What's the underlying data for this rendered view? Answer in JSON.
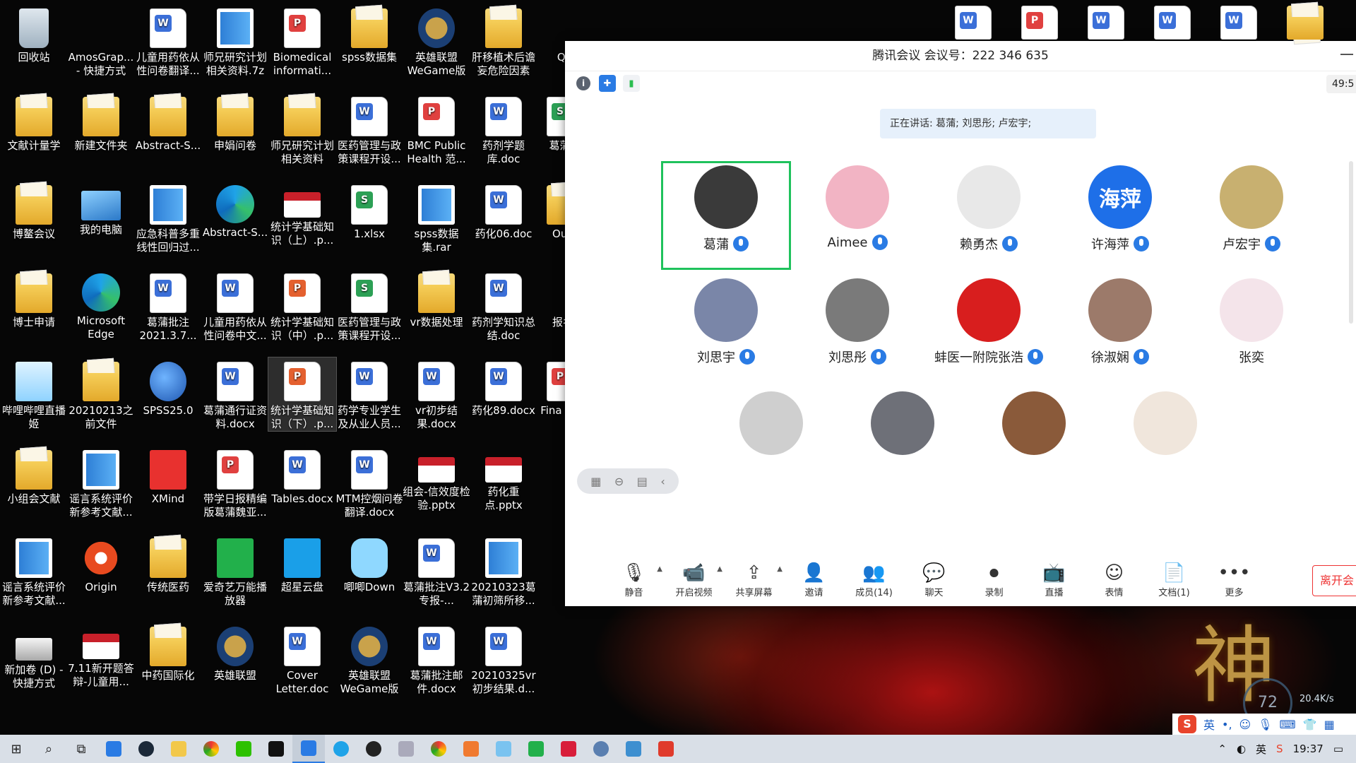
{
  "meeting": {
    "title": "腾讯会议 会议号：222 346 635",
    "timer": "49:5",
    "speaking": "正在讲话: 葛蒲; 刘思彤; 卢宏宇;",
    "participants": [
      {
        "name": "葛蒲",
        "avatar_color": "#3a3a3a",
        "avatar_text": ""
      },
      {
        "name": "Aimee",
        "avatar_color": "#f2b4c4",
        "avatar_text": ""
      },
      {
        "name": "赖勇杰",
        "avatar_color": "#e8e8e8",
        "avatar_text": ""
      },
      {
        "name": "许海萍",
        "avatar_color": "#1e6fe8",
        "avatar_text": "海萍"
      },
      {
        "name": "卢宏宇",
        "avatar_color": "#c8b070",
        "avatar_text": ""
      },
      {
        "name": "刘思宇",
        "avatar_color": "#7a86a8",
        "avatar_text": ""
      },
      {
        "name": "刘思彤",
        "avatar_color": "#7a7a7a",
        "avatar_text": ""
      },
      {
        "name": "蚌医一附院张浩",
        "avatar_color": "#d81e1e",
        "avatar_text": ""
      },
      {
        "name": "徐淑娴",
        "avatar_color": "#9c7a6a",
        "avatar_text": ""
      },
      {
        "name": "张奕",
        "avatar_color": "#f4e4ea",
        "avatar_text": ""
      },
      {
        "name": "",
        "avatar_color": "#cfcfcf",
        "avatar_text": ""
      },
      {
        "name": "",
        "avatar_color": "#6e7078",
        "avatar_text": ""
      },
      {
        "name": "",
        "avatar_color": "#8a5a3a",
        "avatar_text": ""
      },
      {
        "name": "",
        "avatar_color": "#f0e6dc",
        "avatar_text": ""
      }
    ],
    "toolbar": [
      {
        "label": "静音",
        "icon": "microphone-icon",
        "glyph": "🎙",
        "caret": true
      },
      {
        "label": "开启视频",
        "icon": "video-off-icon",
        "glyph": "📹",
        "caret": true
      },
      {
        "label": "共享屏幕",
        "icon": "share-screen-icon",
        "glyph": "⇪",
        "caret": true
      },
      {
        "label": "邀请",
        "icon": "invite-icon",
        "glyph": "👤",
        "caret": false
      },
      {
        "label": "成员(14)",
        "icon": "members-icon",
        "glyph": "👥",
        "caret": false
      },
      {
        "label": "聊天",
        "icon": "chat-icon",
        "glyph": "💬",
        "caret": false
      },
      {
        "label": "录制",
        "icon": "record-icon",
        "glyph": "⏺",
        "caret": false
      },
      {
        "label": "直播",
        "icon": "live-icon",
        "glyph": "📺",
        "caret": false
      },
      {
        "label": "表情",
        "icon": "emoji-icon",
        "glyph": "☺",
        "caret": false
      },
      {
        "label": "文档(1)",
        "icon": "document-icon",
        "glyph": "📄",
        "caret": false
      },
      {
        "label": "更多",
        "icon": "more-icon",
        "glyph": "•••",
        "caret": false
      }
    ],
    "leave": "离开会"
  },
  "desktop": {
    "icons": [
      [
        "回收站",
        "recycle"
      ],
      [
        "AmosGrap... - 快捷方式",
        "app-amos"
      ],
      [
        "儿童用药依从性问卷翻译...",
        "word"
      ],
      [
        "师兄研究计划相关资料.7z",
        "zip"
      ],
      [
        "Biomedical informati...",
        "pdf"
      ],
      [
        "spss数据集",
        "folder"
      ],
      [
        "英雄联盟 WeGame版",
        "lol"
      ],
      [
        "肝移植术后谵妄危险因素",
        "folder"
      ],
      [
        "QC",
        "app"
      ],
      [
        "文献计量学",
        "folder"
      ],
      [
        "新建文件夹",
        "folder"
      ],
      [
        "Abstract-S...",
        "folder"
      ],
      [
        "申娟问卷",
        "folder"
      ],
      [
        "师兄研究计划相关资料",
        "folder"
      ],
      [
        "医药管理与政策课程开设...",
        "word"
      ],
      [
        "BMC Public Health 范...",
        "pdf"
      ],
      [
        "药剂学题库.doc",
        "word"
      ],
      [
        "葛蒲计",
        "xls"
      ],
      [
        "博鳌会议",
        "folder"
      ],
      [
        "我的电脑",
        "pc"
      ],
      [
        "应急科普多重线性回归过...",
        "app-blue"
      ],
      [
        "Abstract-S...",
        "edge"
      ],
      [
        "统计学基础知识（上）.p...",
        "red-card"
      ],
      [
        "1.xlsx",
        "xls"
      ],
      [
        "spss数据集.rar",
        "zip"
      ],
      [
        "药化06.doc",
        "word"
      ],
      [
        "Oum",
        "folder"
      ],
      [
        "博士申请",
        "folder"
      ],
      [
        "Microsoft Edge",
        "edge"
      ],
      [
        "葛蒲批注2021.3.7...",
        "word"
      ],
      [
        "儿童用药依从性问卷中文...",
        "word"
      ],
      [
        "统计学基础知识（中）.p...",
        "ppt"
      ],
      [
        "医药管理与政策课程开设...",
        "xls"
      ],
      [
        "vr数据处理",
        "folder"
      ],
      [
        "药剂学知识总结.doc",
        "word"
      ],
      [
        "报名!",
        "app"
      ],
      [
        "哔哩哔哩直播姬",
        "bili"
      ],
      [
        "20210213之前文件",
        "folder"
      ],
      [
        "SPSS25.0",
        "spss"
      ],
      [
        "葛蒲通行证资料.docx",
        "word"
      ],
      [
        "统计学基础知识（下）.p...",
        "ppt"
      ],
      [
        "药学专业学生及从业人员...",
        "word"
      ],
      [
        "vr初步结果.docx",
        "word"
      ],
      [
        "药化89.docx",
        "word"
      ],
      [
        "Fina phar",
        "pdf"
      ],
      [
        "小组会文献",
        "folder"
      ],
      [
        "谣言系统评价新参考文献...",
        "zip"
      ],
      [
        "XMind",
        "xmind"
      ],
      [
        "带学日报精编版葛蒲魏亚...",
        "pdf"
      ],
      [
        "Tables.docx",
        "word"
      ],
      [
        "MTM控烟问卷翻译.docx",
        "word"
      ],
      [
        "组会-信效度检验.pptx",
        "red-card"
      ],
      [
        "药化重点.pptx",
        "red-card"
      ],
      [
        "",
        ""
      ],
      [
        "谣言系统评价新参考文献...",
        "zip"
      ],
      [
        "Origin",
        "origin"
      ],
      [
        "传统医药",
        "folder"
      ],
      [
        "爱奇艺万能播放器",
        "green"
      ],
      [
        "超星云盘",
        "cloud"
      ],
      [
        "唧唧Down",
        "down"
      ],
      [
        "葛蒲批注V3.2专报-...",
        "word"
      ],
      [
        "20210323葛蒲初筛所移...",
        "zip"
      ],
      [
        "",
        ""
      ],
      [
        "新加卷 (D) - 快捷方式",
        "drive"
      ],
      [
        "7.11新开题答辩-儿童用...",
        "red-card"
      ],
      [
        "中药国际化",
        "folder"
      ],
      [
        "英雄联盟",
        "lol"
      ],
      [
        "Cover Letter.doc",
        "word"
      ],
      [
        "英雄联盟 WeGame版",
        "lol"
      ],
      [
        "葛蒲批注邮件.docx",
        "word"
      ],
      [
        "20210325vr初步结果.d...",
        "word"
      ],
      [
        "",
        ""
      ]
    ]
  },
  "wallpaper": {
    "glyph": "神",
    "gauge": "72",
    "net": "20.4K/s"
  },
  "taskbar": {
    "time": "19:37",
    "lang": "英",
    "ime_lang": "英"
  }
}
